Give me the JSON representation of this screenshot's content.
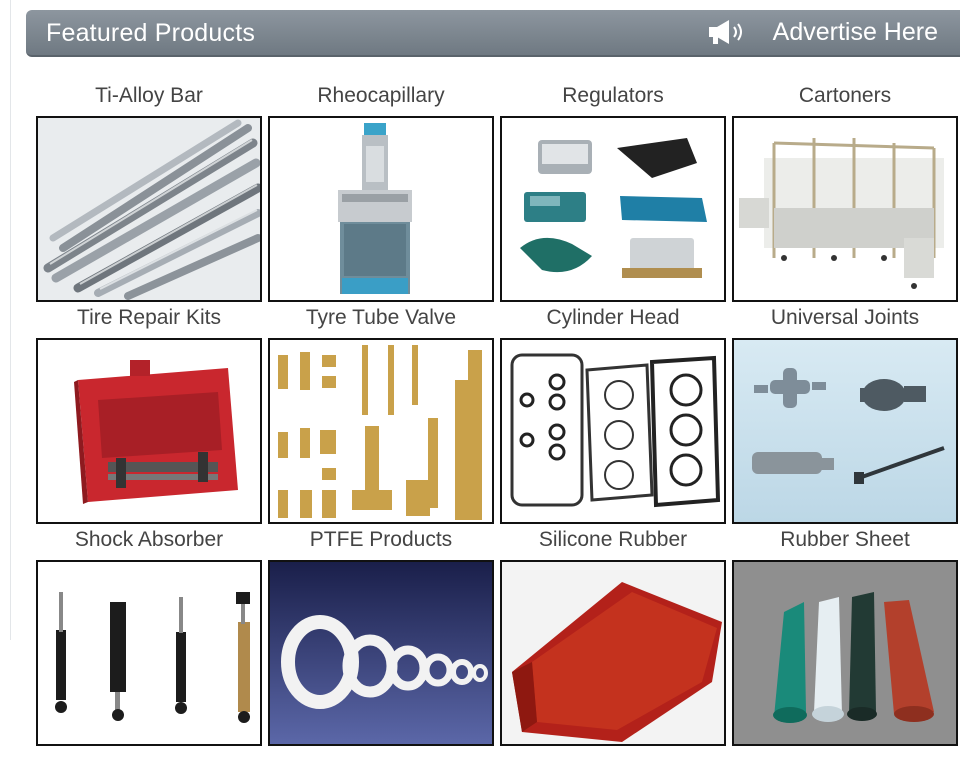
{
  "header": {
    "title": "Featured Products",
    "advertise_label": "Advertise Here",
    "advertise_icon": "megaphone-icon"
  },
  "products": [
    {
      "name": "Ti-Alloy Bar"
    },
    {
      "name": "Rheocapillary"
    },
    {
      "name": "Regulators"
    },
    {
      "name": "Cartoners"
    },
    {
      "name": "Tire Repair Kits"
    },
    {
      "name": "Tyre Tube Valve"
    },
    {
      "name": "Cylinder Head"
    },
    {
      "name": "Universal Joints"
    },
    {
      "name": "Shock Absorber"
    },
    {
      "name": "PTFE Products"
    },
    {
      "name": "Silicone Rubber"
    },
    {
      "name": "Rubber Sheet"
    }
  ]
}
